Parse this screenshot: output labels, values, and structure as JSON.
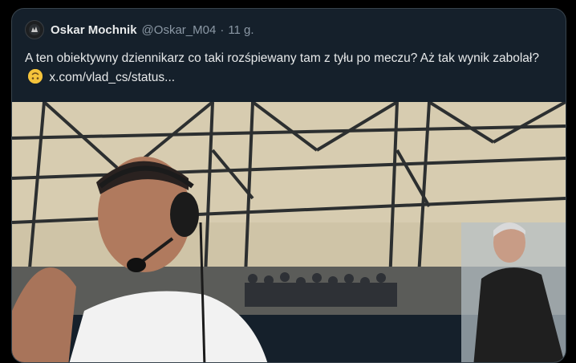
{
  "tweet": {
    "author_name": "Oskar Mochnik",
    "handle": "@Oskar_M04",
    "separator": "·",
    "time": "11 g.",
    "text_part1": "A ten obiektywny dziennikarz co taki rozśpiewany tam z tyłu po meczu? Aż tak wynik zabolał?",
    "emoji_icon": "upside-down-face-emoji",
    "link_text": "x.com/vlad_cs/status..."
  },
  "colors": {
    "card_bg": "#15202b",
    "border": "#38444d",
    "text": "#e7e9ea",
    "secondary_text": "#8b98a5"
  },
  "media": {
    "type": "video-frame",
    "description_icon": "stadium-photo"
  }
}
